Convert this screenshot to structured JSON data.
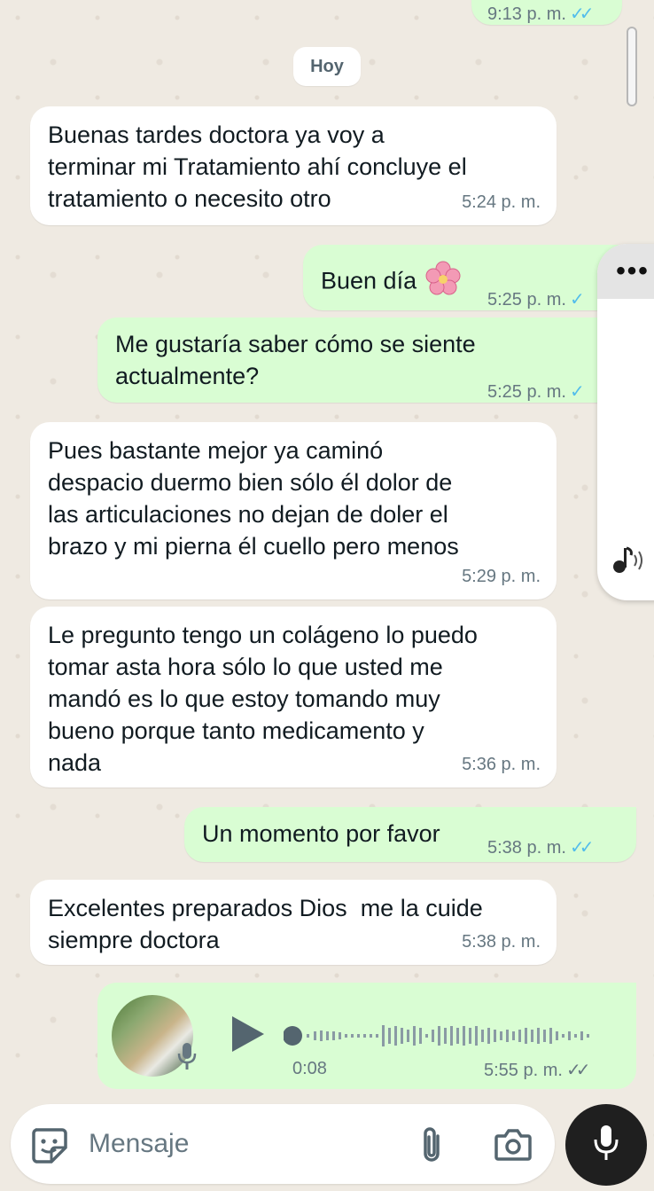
{
  "header_prev_time": "9:13 p. m.",
  "date_chip": "Hoy",
  "messages": [
    {
      "dir": "in",
      "text": "Buenas tardes doctora ya voy a\nterminar mi Tratamiento ahí concluye el\ntratamiento o necesito otro",
      "time": "5:24 p. m."
    },
    {
      "dir": "out",
      "text": "Buen día",
      "time": "5:25 p. m.",
      "emoji": "cherry-blossom-icon",
      "status": "sent"
    },
    {
      "dir": "out",
      "text": "Me gustaría saber cómo se siente\nactualmente?",
      "time": "5:25 p. m.",
      "status": "sent"
    },
    {
      "dir": "in",
      "text": "Pues bastante mejor ya caminó\ndespacio duermo bien sólo él dolor de\nlas articulaciones no dejan de doler el\nbrazo y mi pierna él cuello pero menos",
      "time": "5:29 p. m."
    },
    {
      "dir": "in",
      "text": "Le pregunto tengo un colágeno lo puedo\ntomar asta hora sólo lo que usted me\nmandó es lo que estoy tomando muy\nbueno porque tanto medicamento y\nnada",
      "time": "5:36 p. m."
    },
    {
      "dir": "out",
      "text": "Un momento por favor",
      "time": "5:38 p. m.",
      "status": "read"
    },
    {
      "dir": "in",
      "text": "Excelentes preparados Dios  me la cuide\nsiempre doctora",
      "time": "5:38 p. m."
    }
  ],
  "voice_note": {
    "duration": "0:08",
    "time": "5:55 p. m.",
    "status": "delivered",
    "progress": 0.0
  },
  "composer": {
    "placeholder": "Mensaje"
  },
  "colors": {
    "outgoing": "#d9fdd3",
    "incoming": "#ffffff",
    "read_ticks": "#53bdeb",
    "background": "#efeae2"
  }
}
